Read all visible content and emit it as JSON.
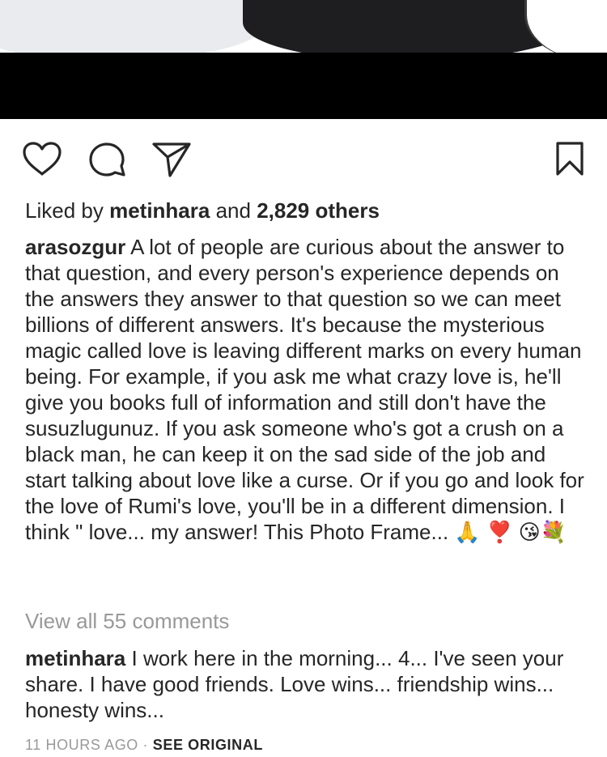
{
  "post": {
    "actions": {
      "like_icon": "heart-outline-icon",
      "comment_icon": "comment-bubble-icon",
      "share_icon": "paper-plane-icon",
      "save_icon": "bookmark-outline-icon"
    },
    "likes": {
      "prefix": "Liked by",
      "user": "metinhara",
      "connector": "and",
      "others": "2,829 others"
    },
    "caption": {
      "username": "arasozgur",
      "text": "A lot of people are curious about the answer to that question, and every person's experience depends on the answers they answer to that question so we can meet billions of different answers. It's because the mysterious magic called love is leaving different marks on every human being. For example, if you ask me what crazy love is, he'll give you books full of information and still don't have the susuzlugunuz. If you ask someone who's got a crush on a black man, he can keep it on the sad side of the job and start talking about love like a curse. Or if you go and look for the love of Rumi's love, you'll be in a different dimension. I think \" love... my answer! This Photo Frame...",
      "emojis": "🙏 ❣️ 😘💐"
    },
    "view_comments": "View all 55 comments",
    "comment": {
      "username": "metinhara",
      "text": "I work here in the morning... 4... I've seen your share. I have good friends. Love wins... friendship wins... honesty wins..."
    },
    "meta": {
      "time": "11 HOURS AGO",
      "separator": "·",
      "see_original": "SEE ORIGINAL"
    }
  }
}
